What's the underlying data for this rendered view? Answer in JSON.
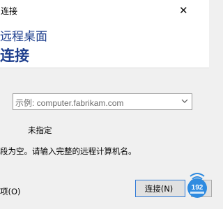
{
  "window": {
    "title": "连接",
    "close_glyph": "✕"
  },
  "header": {
    "app_name": "远程桌面",
    "title": "连接"
  },
  "computer": {
    "placeholder": "示例: computer.fabrikam.com"
  },
  "user_label": "未指定",
  "hint": "段为空。请输入完整的远程计算机名。",
  "options_label": "项(O)",
  "connect_button": "连接(N)",
  "watermark": {
    "text": "192",
    "icon": "wifi-icon"
  },
  "colors": {
    "header_text": "#1e3f8e",
    "button_focus_border": "#2f7ad8"
  }
}
